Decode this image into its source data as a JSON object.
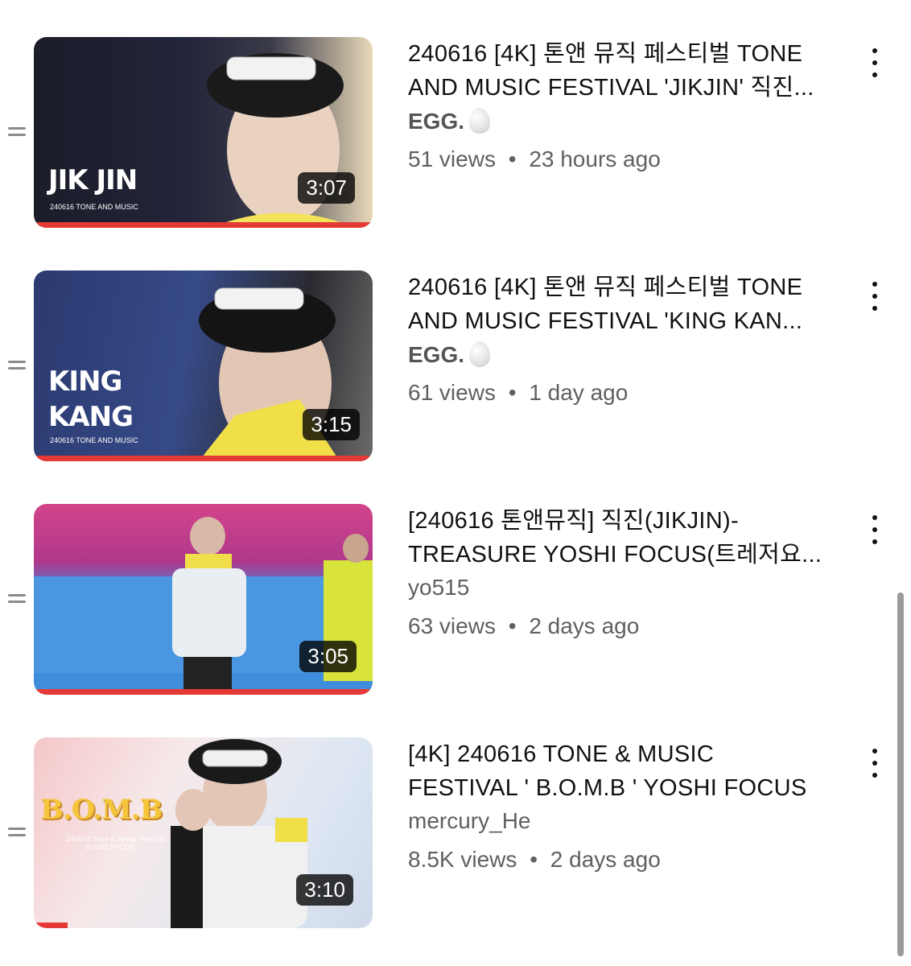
{
  "videos": [
    {
      "title_line1": "240616 [4K] 톤앤 뮤직 페스티벌 TONE",
      "title_line2": "AND MUSIC FESTIVAL 'JIKJIN' 직진...",
      "channel": "EGG.",
      "channel_emoji": "egg-icon",
      "views": "51 views",
      "age": "23 hours ago",
      "duration": "3:07",
      "thumb_text": "JIK JIN",
      "thumb_sub": "240616 TONE AND MUSIC",
      "progress": 1.0
    },
    {
      "title_line1": "240616 [4K] 톤앤 뮤직 페스티벌 TONE",
      "title_line2": "AND MUSIC FESTIVAL 'KING KAN...",
      "channel": "EGG.",
      "channel_emoji": "egg-icon",
      "views": "61 views",
      "age": "1 day ago",
      "duration": "3:15",
      "thumb_text_1": "KING",
      "thumb_text_2": "KANG",
      "thumb_sub": "240616 TONE AND MUSIC",
      "progress": 0.99
    },
    {
      "title_line1": "[240616 톤앤뮤직] 직진(JIKJIN)-",
      "title_line2": "TREASURE YOSHI FOCUS(트레저요...",
      "channel": "yo515",
      "views": "63 views",
      "age": "2 days ago",
      "duration": "3:05",
      "progress": 1.0
    },
    {
      "title_line1": "[4K] 240616 TONE & MUSIC",
      "title_line2": "FESTIVAL ' B.O.M.B ' YOSHI FOCUS",
      "channel": "mercury_He",
      "views": "8.5K views",
      "age": "2 days ago",
      "duration": "3:10",
      "thumb_text": "B.O.M.B",
      "thumb_sub_1": "240616 Tone & Music Festival",
      "thumb_sub_2": "YOSHI FOCUS",
      "progress": 0.1
    }
  ],
  "separator": "•",
  "colors": {
    "progress": "#e53935",
    "meta": "#606060"
  }
}
